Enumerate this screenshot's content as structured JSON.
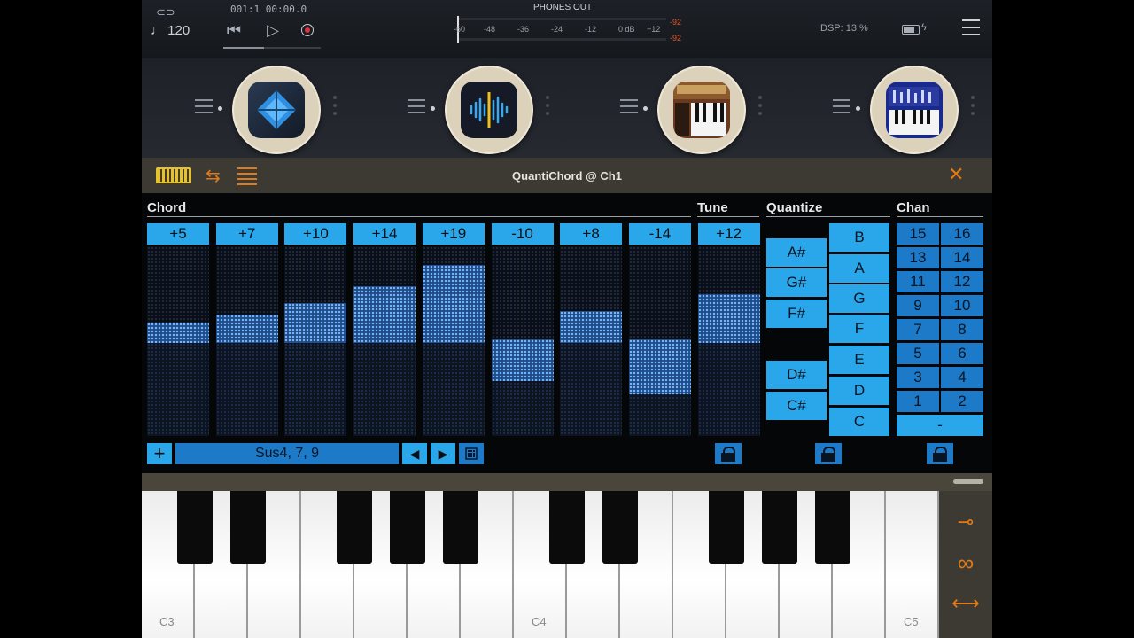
{
  "topbar": {
    "tempo": "♩ 120",
    "position": "001:1  00:00.0",
    "meter_title": "PHONES OUT",
    "meter_ticks": [
      "-60",
      "-48",
      "-36",
      "-24",
      "-12",
      "0 dB",
      "+12"
    ],
    "peak_top": "-92",
    "peak_bottom": "-92",
    "dsp": "DSP: 13 %",
    "icons": [
      "link-icon",
      "rewind-icon",
      "play-icon",
      "record-icon",
      "battery-icon",
      "menu-icon"
    ]
  },
  "slots": [
    "plugin-slot-1",
    "plugin-slot-2",
    "plugin-slot-3",
    "plugin-slot-4"
  ],
  "panel": {
    "title": "QuantiChord @ Ch1",
    "close": "✕",
    "sections": {
      "chord": "Chord",
      "tune": "Tune",
      "quantize": "Quantize",
      "chan": "Chan"
    },
    "chord_columns": [
      {
        "label": "+5",
        "fill_top": 0.4,
        "fill_bottom": 0.51
      },
      {
        "label": "+7",
        "fill_top": 0.36,
        "fill_bottom": 0.51
      },
      {
        "label": "+10",
        "fill_top": 0.3,
        "fill_bottom": 0.51
      },
      {
        "label": "+14",
        "fill_top": 0.21,
        "fill_bottom": 0.51
      },
      {
        "label": "+19",
        "fill_top": 0.1,
        "fill_bottom": 0.51
      },
      {
        "label": "-10",
        "fill_top": 0.49,
        "fill_bottom": 0.71
      },
      {
        "label": "+8",
        "fill_top": 0.34,
        "fill_bottom": 0.51
      },
      {
        "label": "-14",
        "fill_top": 0.49,
        "fill_bottom": 0.78
      }
    ],
    "tune_column": {
      "label": "+12",
      "fill_top": 0.25,
      "fill_bottom": 0.51
    },
    "add_label": "+",
    "preset_name": "Sus4, 7, 9",
    "prev_label": "◀",
    "next_label": "▶",
    "quantize_sharps": [
      "A#",
      "G#",
      "F#",
      "D#",
      "C#"
    ],
    "quantize_naturals": [
      "B",
      "A",
      "G",
      "F",
      "E",
      "D",
      "C"
    ],
    "channels": [
      [
        "15",
        "16"
      ],
      [
        "13",
        "14"
      ],
      [
        "11",
        "12"
      ],
      [
        "9",
        "10"
      ],
      [
        "7",
        "8"
      ],
      [
        "5",
        "6"
      ],
      [
        "3",
        "4"
      ],
      [
        "1",
        "2"
      ]
    ],
    "chan_dash": "-"
  },
  "keyboard": {
    "labels": [
      "C3",
      "C4",
      "C5"
    ],
    "white_count": 15,
    "side_icons": [
      "wrench-icon",
      "infinity-icon",
      "arrows-icon"
    ]
  }
}
